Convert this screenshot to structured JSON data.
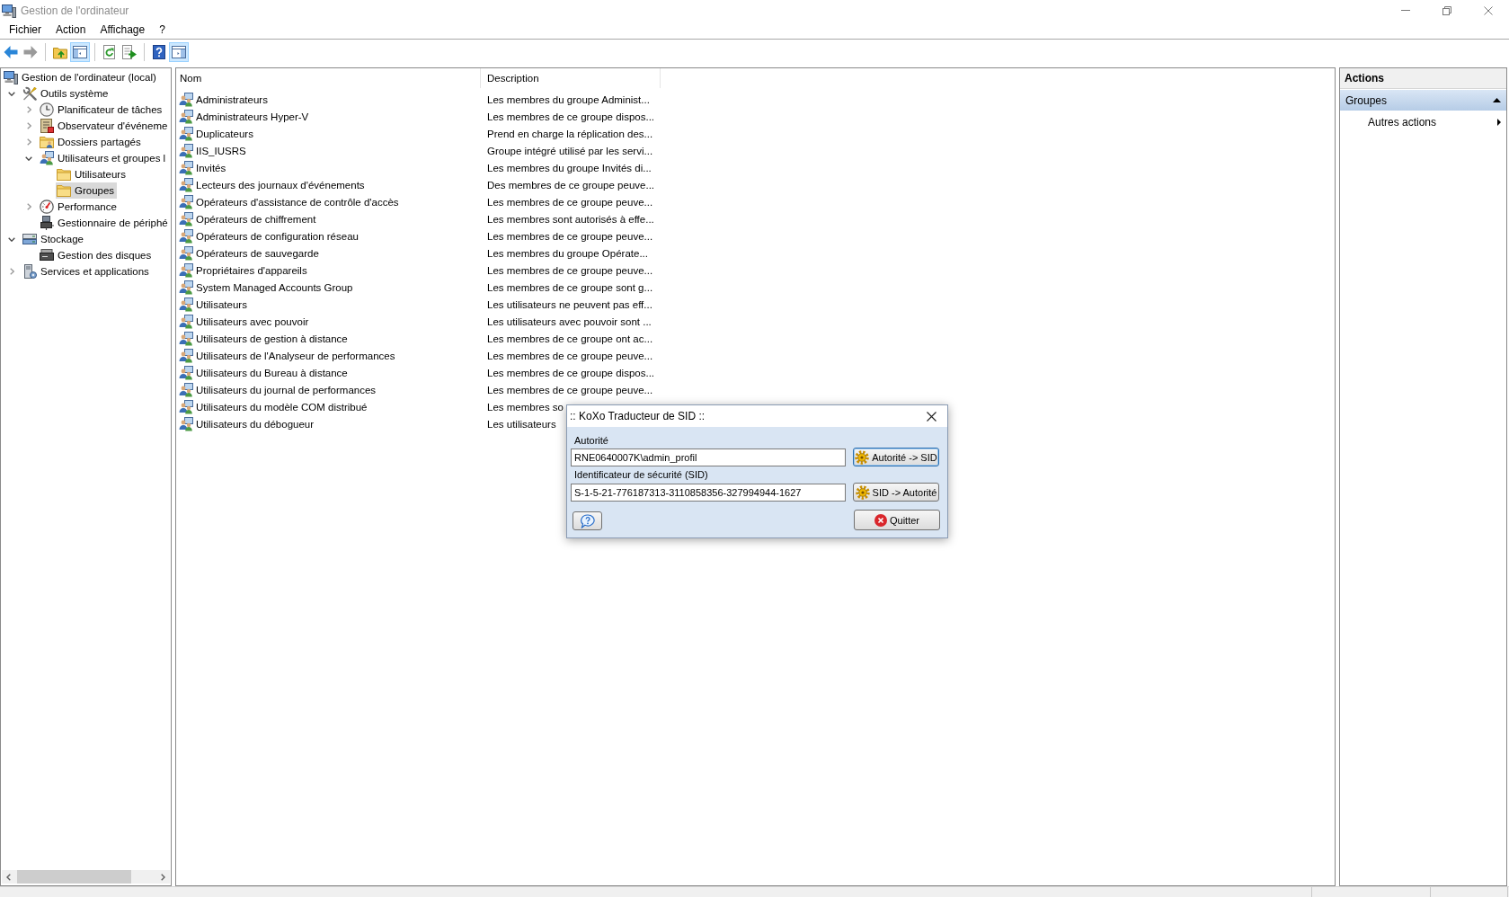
{
  "window": {
    "title": "Gestion de l'ordinateur"
  },
  "menu": [
    "Fichier",
    "Action",
    "Affichage",
    "?"
  ],
  "toolbar": [
    {
      "kind": "back",
      "disabled": false,
      "pressed": false
    },
    {
      "kind": "forward",
      "disabled": true,
      "pressed": false
    },
    {
      "kind": "separator"
    },
    {
      "kind": "up",
      "disabled": false,
      "pressed": false
    },
    {
      "kind": "tree",
      "disabled": false,
      "pressed": true
    },
    {
      "kind": "separator"
    },
    {
      "kind": "refresh",
      "disabled": false,
      "pressed": false
    },
    {
      "kind": "export",
      "disabled": false,
      "pressed": false
    },
    {
      "kind": "separator"
    },
    {
      "kind": "help",
      "disabled": false,
      "pressed": false
    },
    {
      "kind": "actions",
      "disabled": false,
      "pressed": true
    }
  ],
  "tree": [
    {
      "label": "Gestion de l'ordinateur (local)",
      "kind": "computer",
      "selected": false,
      "children": [
        {
          "label": "Outils système",
          "kind": "tools",
          "selected": false,
          "expanded": true,
          "children": [
            {
              "label": "Planificateur de tâches",
              "kind": "clock",
              "selected": false,
              "expanded": false
            },
            {
              "label": "Observateur d'événeme",
              "kind": "log",
              "selected": false,
              "expanded": false
            },
            {
              "label": "Dossiers partagés",
              "kind": "shared-folder",
              "selected": false,
              "expanded": false
            },
            {
              "label": "Utilisateurs et groupes l",
              "kind": "users",
              "selected": false,
              "expanded": true,
              "children": [
                {
                  "label": "Utilisateurs",
                  "kind": "folder",
                  "selected": false
                },
                {
                  "label": "Groupes",
                  "kind": "folder",
                  "selected": true
                }
              ]
            },
            {
              "label": "Performance",
              "kind": "performance",
              "selected": false,
              "expanded": false
            },
            {
              "label": "Gestionnaire de périphé",
              "kind": "device",
              "selected": false
            }
          ]
        },
        {
          "label": "Stockage",
          "kind": "storage",
          "selected": false,
          "expanded": true,
          "children": [
            {
              "label": "Gestion des disques",
              "kind": "disk",
              "selected": false
            }
          ]
        },
        {
          "label": "Services et applications",
          "kind": "services",
          "selected": false,
          "expanded": false
        }
      ]
    }
  ],
  "list": {
    "columns": [
      "Nom",
      "Description"
    ],
    "rows": [
      {
        "name": "Administrateurs",
        "description": "Les membres du groupe Administ..."
      },
      {
        "name": "Administrateurs Hyper-V",
        "description": "Les membres de ce groupe dispos..."
      },
      {
        "name": "Duplicateurs",
        "description": "Prend en charge la réplication des..."
      },
      {
        "name": "IIS_IUSRS",
        "description": "Groupe intégré utilisé par les servi..."
      },
      {
        "name": "Invités",
        "description": "Les membres du groupe Invités di..."
      },
      {
        "name": "Lecteurs des journaux d'événements",
        "description": "Des membres de ce groupe peuve..."
      },
      {
        "name": "Opérateurs d'assistance de contrôle d'accès",
        "description": "Les membres de ce groupe peuve..."
      },
      {
        "name": "Opérateurs de chiffrement",
        "description": "Les membres sont autorisés à effe..."
      },
      {
        "name": "Opérateurs de configuration réseau",
        "description": "Les membres de ce groupe peuve..."
      },
      {
        "name": "Opérateurs de sauvegarde",
        "description": "Les membres du groupe Opérate..."
      },
      {
        "name": "Propriétaires d'appareils",
        "description": "Les membres de ce groupe peuve..."
      },
      {
        "name": "System Managed Accounts Group",
        "description": "Les membres de ce groupe sont g..."
      },
      {
        "name": "Utilisateurs",
        "description": "Les utilisateurs ne peuvent pas eff..."
      },
      {
        "name": "Utilisateurs avec pouvoir",
        "description": "Les utilisateurs avec pouvoir sont ..."
      },
      {
        "name": "Utilisateurs de gestion à distance",
        "description": "Les membres de ce groupe ont ac..."
      },
      {
        "name": "Utilisateurs de l'Analyseur de performances",
        "description": "Les membres de ce groupe peuve..."
      },
      {
        "name": "Utilisateurs du Bureau à distance",
        "description": "Les membres de ce groupe dispos..."
      },
      {
        "name": "Utilisateurs du journal de performances",
        "description": "Les membres de ce groupe peuve..."
      },
      {
        "name": "Utilisateurs du modèle COM distribué",
        "description": "Les membres so"
      },
      {
        "name": "Utilisateurs du débogueur",
        "description": "Les utilisateurs"
      }
    ]
  },
  "actions": {
    "title": "Actions",
    "sections": [
      {
        "title": "Groupes",
        "expanded": true,
        "items": [
          {
            "label": "Autres actions",
            "submenu": true
          }
        ]
      }
    ]
  },
  "dialog": {
    "title": ":: KoXo Traducteur de SID ::",
    "fields": [
      {
        "label": "Autorité",
        "value": "RNE0640007K\\admin_profil",
        "button": "Autorité -> SID"
      },
      {
        "label": "Identificateur de sécurité (SID)",
        "value": "S-1-5-21-776187313-3110858356-327994944-1627",
        "button": "SID -> Autorité"
      }
    ],
    "quit_button": "Quitter"
  }
}
